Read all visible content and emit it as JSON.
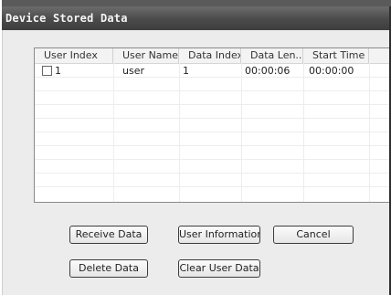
{
  "window": {
    "title": "Device Stored Data"
  },
  "table": {
    "columns": [
      "User Index",
      "User Name",
      "Data Index",
      "Data Len...",
      "Start Time"
    ],
    "rows": [
      {
        "checked": false,
        "user_index": "1",
        "user_name": "user",
        "data_index": "1",
        "data_length": "00:00:06",
        "start_time": "00:00:00"
      }
    ]
  },
  "buttons": {
    "receive_data": "Receive Data",
    "user_information": "User Information",
    "cancel": "Cancel",
    "delete_data": "Delete Data",
    "clear_user_data": "Clear User Data"
  }
}
